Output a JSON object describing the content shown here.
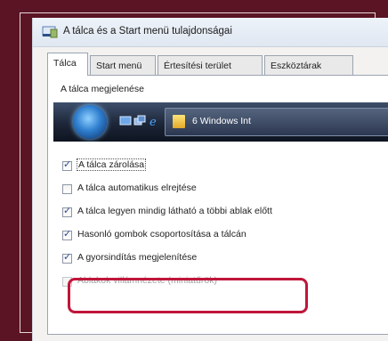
{
  "window": {
    "title": "A tálca és a Start menü tulajdonságai",
    "app_icon": "taskbar-properties-icon"
  },
  "tabs": [
    {
      "label": "Tálca",
      "active": true
    },
    {
      "label": "Start menü",
      "active": false
    },
    {
      "label": "Értesítési terület",
      "active": false
    },
    {
      "label": "Eszköztárak",
      "active": false
    }
  ],
  "appearance_group": {
    "label": "A tálca megjelenése",
    "preview": {
      "start_button": "windows-start-orb-icon",
      "quicklaunch_icons": [
        "show-desktop-icon",
        "switch-windows-icon",
        "internet-explorer-icon"
      ],
      "task_button_icon": "folder-icon",
      "task_button_label": "6 Windows Int"
    }
  },
  "options": [
    {
      "label": "A tálca zárolása",
      "checked": true,
      "enabled": true,
      "focused": true
    },
    {
      "label": "A tálca automatikus elrejtése",
      "checked": false,
      "enabled": true,
      "focused": false
    },
    {
      "label": "A tálca legyen mindig látható a többi ablak előtt",
      "checked": true,
      "enabled": true,
      "focused": false
    },
    {
      "label": "Hasonló gombok csoportosítása a tálcán",
      "checked": true,
      "enabled": true,
      "focused": false
    },
    {
      "label": "A gyorsindítás megjelenítése",
      "checked": true,
      "enabled": true,
      "focused": false
    },
    {
      "label": "Ablakok villámnézete (miniatűrök)",
      "checked": false,
      "enabled": false,
      "focused": false
    }
  ],
  "colors": {
    "background": "#5a1424",
    "highlight_border": "#c0163a",
    "checkmark": "#2a4d9e"
  }
}
